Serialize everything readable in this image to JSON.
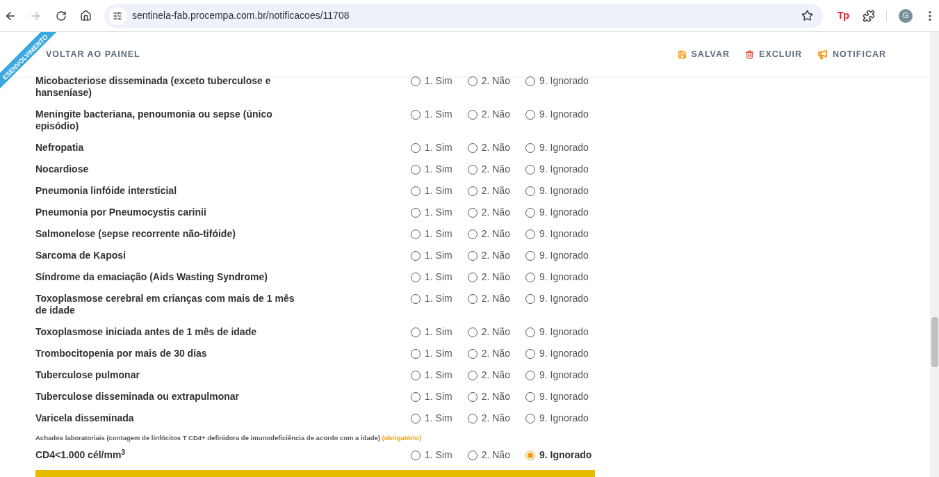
{
  "browser": {
    "url": "sentinela-fab.procempa.com.br/notificacoes/11708",
    "forward_disabled": true,
    "avatar": "G",
    "extension": "Tp"
  },
  "ribbon": "ESENVOLVIMENTO",
  "header": {
    "back": "VOLTAR AO PAINEL",
    "actions": [
      {
        "kind": "save",
        "label": "SALVAR"
      },
      {
        "kind": "delete",
        "label": "EXCLUIR"
      },
      {
        "kind": "notify",
        "label": "NOTIFICAR"
      }
    ]
  },
  "rows": [
    {
      "label": "Micobacteriose disseminada (exceto tuberculose e hanseníase)",
      "options": [
        {
          "label": "1. Sim",
          "selected": false
        },
        {
          "label": "2. Não",
          "selected": false
        },
        {
          "label": "9. Ignorado",
          "selected": false
        }
      ]
    },
    {
      "label": "Meningite bacteriana, penoumonia ou sepse (único episódio)",
      "options": [
        {
          "label": "1. Sim",
          "selected": false
        },
        {
          "label": "2. Não",
          "selected": false
        },
        {
          "label": "9. Ignorado",
          "selected": false
        }
      ]
    },
    {
      "label": "Nefropatia",
      "options": [
        {
          "label": "1. Sim",
          "selected": false
        },
        {
          "label": "2. Não",
          "selected": false
        },
        {
          "label": "9. Ignorado",
          "selected": false
        }
      ]
    },
    {
      "label": "Nocardiose",
      "options": [
        {
          "label": "1. Sim",
          "selected": false
        },
        {
          "label": "2. Não",
          "selected": false
        },
        {
          "label": "9. Ignorado",
          "selected": false
        }
      ]
    },
    {
      "label": "Pneumonia linfóide intersticial",
      "options": [
        {
          "label": "1. Sim",
          "selected": false
        },
        {
          "label": "2. Não",
          "selected": false
        },
        {
          "label": "9. Ignorado",
          "selected": false
        }
      ]
    },
    {
      "label": "Pneumonia por Pneumocystis carinii",
      "options": [
        {
          "label": "1. Sim",
          "selected": false
        },
        {
          "label": "2. Não",
          "selected": false
        },
        {
          "label": "9. Ignorado",
          "selected": false
        }
      ]
    },
    {
      "label": "Salmonelose (sepse recorrente não-tifóide)",
      "options": [
        {
          "label": "1. Sim",
          "selected": false
        },
        {
          "label": "2. Não",
          "selected": false
        },
        {
          "label": "9. Ignorado",
          "selected": false
        }
      ]
    },
    {
      "label": "Sarcoma de Kaposi",
      "options": [
        {
          "label": "1. Sim",
          "selected": false
        },
        {
          "label": "2. Não",
          "selected": false
        },
        {
          "label": "9. Ignorado",
          "selected": false
        }
      ]
    },
    {
      "label": "Síndrome da emaciação (Aids Wasting Syndrome)",
      "options": [
        {
          "label": "1. Sim",
          "selected": false
        },
        {
          "label": "2. Não",
          "selected": false
        },
        {
          "label": "9. Ignorado",
          "selected": false
        }
      ]
    },
    {
      "label": "Toxoplasmose cerebral em crianças com mais de 1 mês de idade",
      "options": [
        {
          "label": "1. Sim",
          "selected": false
        },
        {
          "label": "2. Não",
          "selected": false
        },
        {
          "label": "9. Ignorado",
          "selected": false
        }
      ]
    },
    {
      "label": "Toxoplasmose iniciada antes de 1 mês de idade",
      "options": [
        {
          "label": "1. Sim",
          "selected": false
        },
        {
          "label": "2. Não",
          "selected": false
        },
        {
          "label": "9. Ignorado",
          "selected": false
        }
      ]
    },
    {
      "label": "Trombocitopenia por mais de 30 dias",
      "options": [
        {
          "label": "1. Sim",
          "selected": false
        },
        {
          "label": "2. Não",
          "selected": false
        },
        {
          "label": "9. Ignorado",
          "selected": false
        }
      ]
    },
    {
      "label": "Tuberculose pulmonar",
      "options": [
        {
          "label": "1. Sim",
          "selected": false
        },
        {
          "label": "2. Não",
          "selected": false
        },
        {
          "label": "9. Ignorado",
          "selected": false
        }
      ]
    },
    {
      "label": "Tuberculose disseminada ou extrapulmonar",
      "options": [
        {
          "label": "1. Sim",
          "selected": false
        },
        {
          "label": "2. Não",
          "selected": false
        },
        {
          "label": "9. Ignorado",
          "selected": false
        }
      ]
    },
    {
      "label": "Varicela disseminada",
      "options": [
        {
          "label": "1. Sim",
          "selected": false
        },
        {
          "label": "2. Não",
          "selected": false
        },
        {
          "label": "9. Ignorado",
          "selected": false
        }
      ]
    }
  ],
  "lab_section": {
    "title": "Achados laboratoriais (contagem de linfócitos T CD4+ definidora de imunodeficiência de acordo com a idade)",
    "required": "(obrigatório)"
  },
  "lab_rows": [
    {
      "label": "CD4<1.000 cél/mm$^{3}$",
      "options": [
        {
          "label": "1. Sim",
          "selected": false
        },
        {
          "label": "2. Não",
          "selected": false
        },
        {
          "label": "9. Ignorado",
          "selected": true
        }
      ]
    }
  ]
}
